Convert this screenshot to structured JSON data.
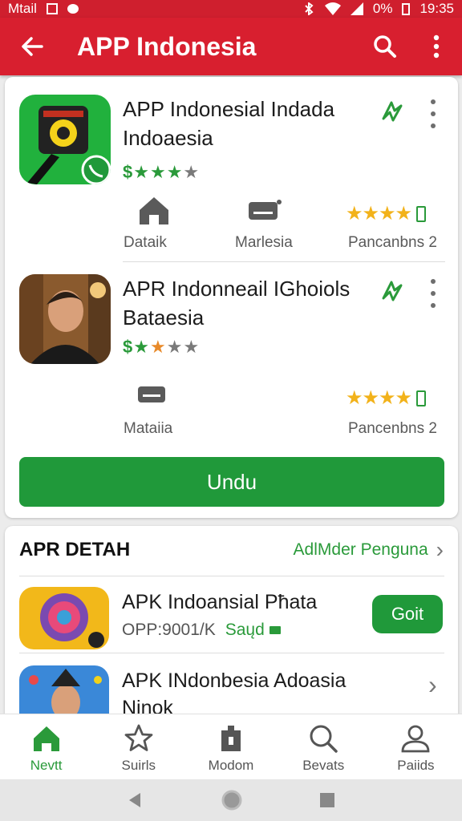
{
  "status_bar": {
    "left_text": "Mtail",
    "battery": "0%",
    "time": "19:35"
  },
  "app_bar": {
    "title": "APP Indonesia"
  },
  "apps": [
    {
      "name": "APP Indonesial Indada Indoaesia",
      "rating_prefix": "$",
      "rating_stars": "★★★★",
      "meta": [
        {
          "icon": "home-icon",
          "label": "Dataik"
        },
        {
          "icon": "router-icon",
          "label": "Marlesia"
        }
      ],
      "score_stars": "★★★★",
      "score_label": "Pancanbns 2"
    },
    {
      "name": "APR Indonneail IGhoiols Bataesia",
      "rating_prefix": "$",
      "rating_stars": "★★★★",
      "meta": [
        {
          "icon": "router-icon",
          "label": "Mataiia"
        }
      ],
      "score_stars": "★★★★",
      "score_label": "Pancenbns 2"
    }
  ],
  "primary_button": "Undu",
  "section": {
    "title": "APR DETAH",
    "link": "AdlMder Penguna",
    "rows": [
      {
        "title": "APK Indoansial Pħata",
        "sub": "OPP:9001/K",
        "badge": "Saųd",
        "button": "Goit"
      },
      {
        "title": "APK INdonbesia Adoasia Ninok"
      }
    ]
  },
  "bottom_nav": [
    {
      "label": "Nevtt",
      "icon": "home-icon",
      "active": true
    },
    {
      "label": "Suirls",
      "icon": "star-icon",
      "active": false
    },
    {
      "label": "Modom",
      "icon": "file-icon",
      "active": false
    },
    {
      "label": "Bevats",
      "icon": "search-icon",
      "active": false
    },
    {
      "label": "Paiids",
      "icon": "person-icon",
      "active": false
    }
  ],
  "colors": {
    "brand_red": "#d81f2f",
    "accent_green": "#20993a",
    "star_yellow": "#f2b21a"
  }
}
